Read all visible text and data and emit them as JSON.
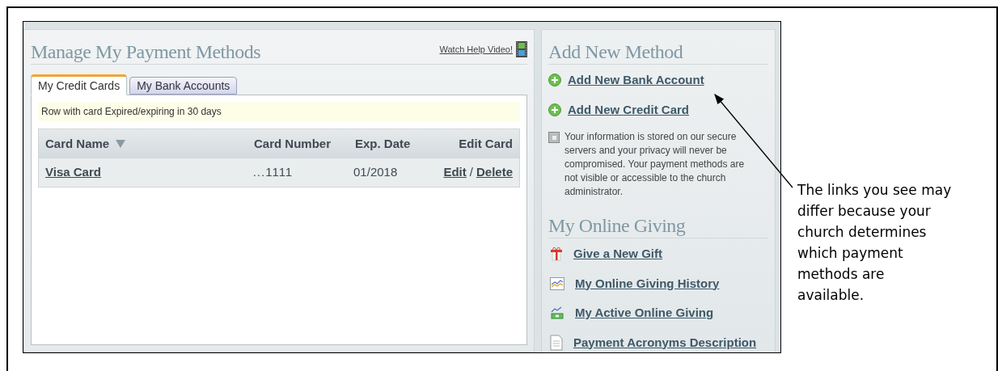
{
  "panel": {
    "title": "Manage My Payment Methods",
    "help_link": "Watch Help Video!",
    "tabs": [
      {
        "label": "My Credit Cards",
        "selected": true
      },
      {
        "label": "My Bank Accounts",
        "selected": false
      }
    ],
    "notice": "Row with card Expired/expiring in 30 days",
    "table": {
      "columns": [
        {
          "label": "Card Name",
          "sorted": true
        },
        {
          "label": "Card Number",
          "sorted": false
        },
        {
          "label": "Exp. Date",
          "sorted": false
        },
        {
          "label": "Edit Card",
          "sorted": false
        }
      ],
      "rows": [
        {
          "card_name": "Visa Card",
          "card_number": "...1111",
          "exp_date": "01/2018",
          "edit": "Edit",
          "separator": "/",
          "delete": "Delete"
        }
      ]
    }
  },
  "sidebar": {
    "sections": [
      {
        "title": "Add New Method",
        "links": [
          {
            "label": "Add New Bank Account",
            "kind": "add"
          },
          {
            "label": "Add New Credit Card",
            "kind": "add"
          }
        ],
        "note": "Your information is stored on our secure servers and your privacy will never be compromised. Your payment methods are not visible or accessible to the church administrator."
      },
      {
        "title": "My Online Giving",
        "links": [
          {
            "label": "Give a New Gift",
            "kind": "gift"
          },
          {
            "label": "My Online Giving History",
            "kind": "history"
          },
          {
            "label": "My Active Online Giving",
            "kind": "active"
          },
          {
            "label": "Payment Acronyms Description",
            "kind": "document"
          }
        ]
      }
    ]
  },
  "callout": {
    "text": "The links you see may differ because your church determines which payment methods are available."
  }
}
